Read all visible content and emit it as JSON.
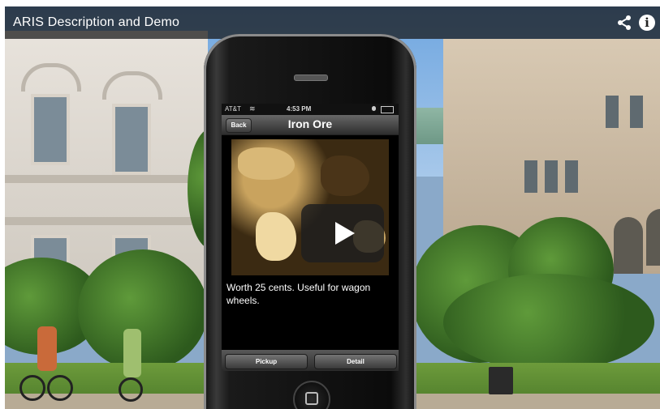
{
  "video": {
    "title": "ARIS Description and Demo",
    "icons": {
      "share": "share-icon",
      "info": "info-icon"
    }
  },
  "phone": {
    "status": {
      "carrier": "AT&T",
      "wifi": "wifi-icon",
      "time": "4:53 PM"
    },
    "nav": {
      "back_label": "Back",
      "title": "Iron Ore"
    },
    "item_description": "Worth 25 cents. Useful for wagon wheels.",
    "buttons": {
      "pickup": "Pickup",
      "detail": "Detail"
    }
  },
  "colors": {
    "topbar": "#141414",
    "phone_body": "#111111",
    "nav_bar": "#4a4a4a"
  }
}
